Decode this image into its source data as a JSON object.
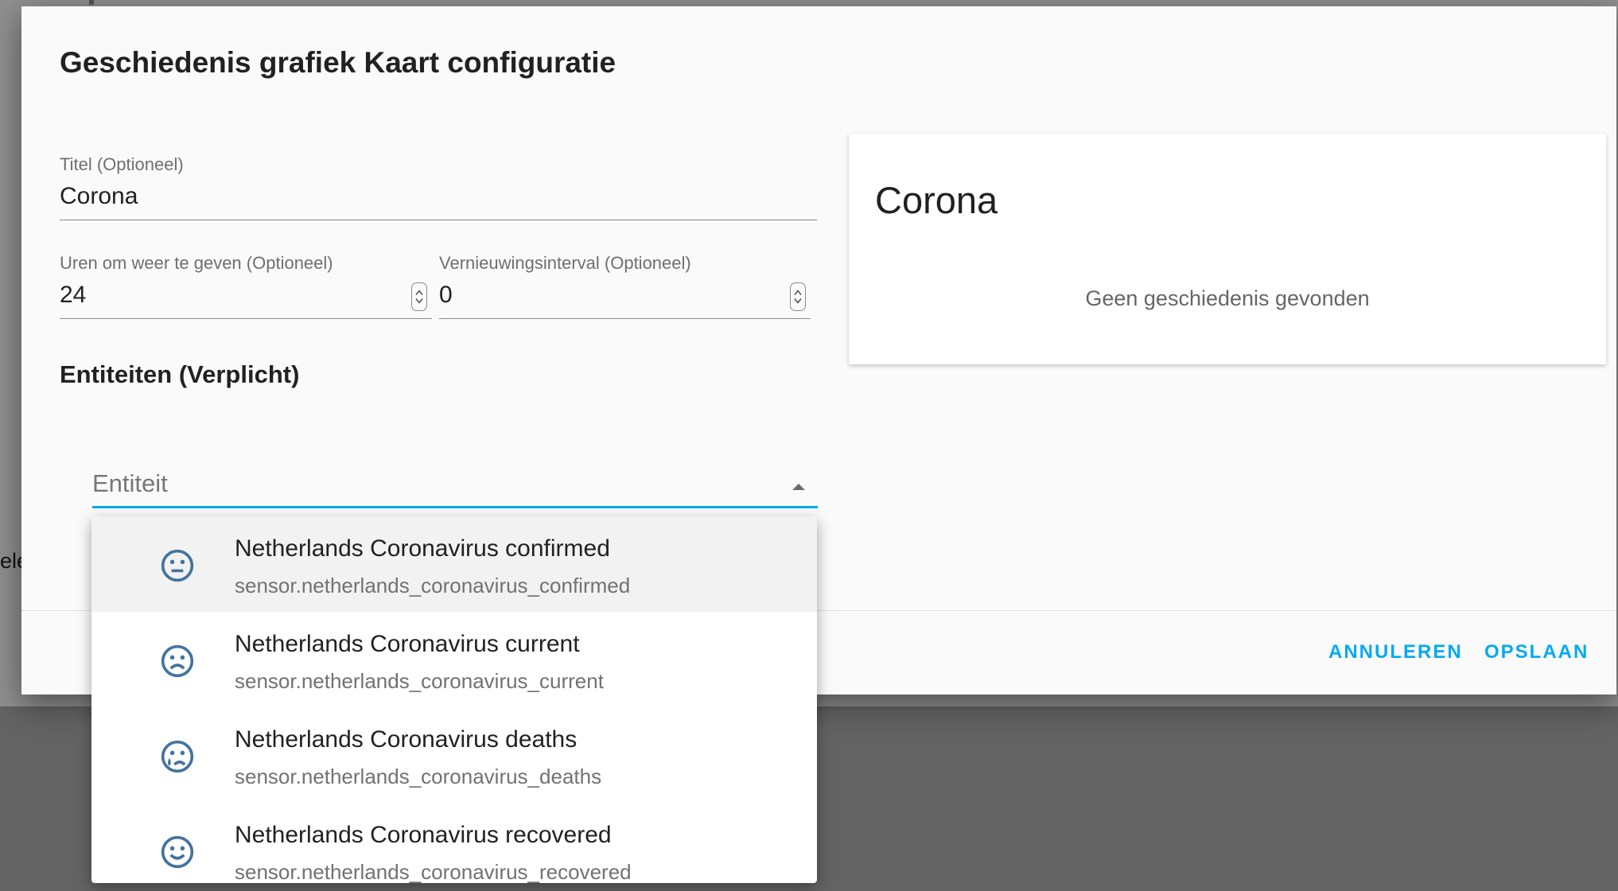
{
  "background": {
    "partial_text": "ele"
  },
  "dialog": {
    "title": "Geschiedenis grafiek Kaart configuratie",
    "title_field": {
      "label": "Titel (Optioneel)",
      "value": "Corona"
    },
    "hours_field": {
      "label": "Uren om weer te geven (Optioneel)",
      "value": "24"
    },
    "refresh_field": {
      "label": "Vernieuwingsinterval (Optioneel)",
      "value": "0"
    },
    "entities_heading": "Entiteiten (Verplicht)",
    "entity_picker": {
      "placeholder": "Entiteit"
    },
    "preview": {
      "title": "Corona",
      "empty_message": "Geen geschiedenis gevonden"
    },
    "actions": {
      "cancel_label": "ANNULEREN",
      "save_label": "OPSLAAN"
    }
  },
  "dropdown": {
    "options": [
      {
        "name": "Netherlands Coronavirus confirmed",
        "entity_id": "sensor.netherlands_coronavirus_confirmed",
        "icon": "neutral-face-icon",
        "highlighted": true
      },
      {
        "name": "Netherlands Coronavirus current",
        "entity_id": "sensor.netherlands_coronavirus_current",
        "icon": "sad-face-icon",
        "highlighted": false
      },
      {
        "name": "Netherlands Coronavirus deaths",
        "entity_id": "sensor.netherlands_coronavirus_deaths",
        "icon": "crying-face-icon",
        "highlighted": false
      },
      {
        "name": "Netherlands Coronavirus recovered",
        "entity_id": "sensor.netherlands_coronavirus_recovered",
        "icon": "happy-face-icon",
        "highlighted": false
      }
    ]
  },
  "colors": {
    "accent": "#03a9f4",
    "icon": "#44739e",
    "title_text": "#212121"
  }
}
